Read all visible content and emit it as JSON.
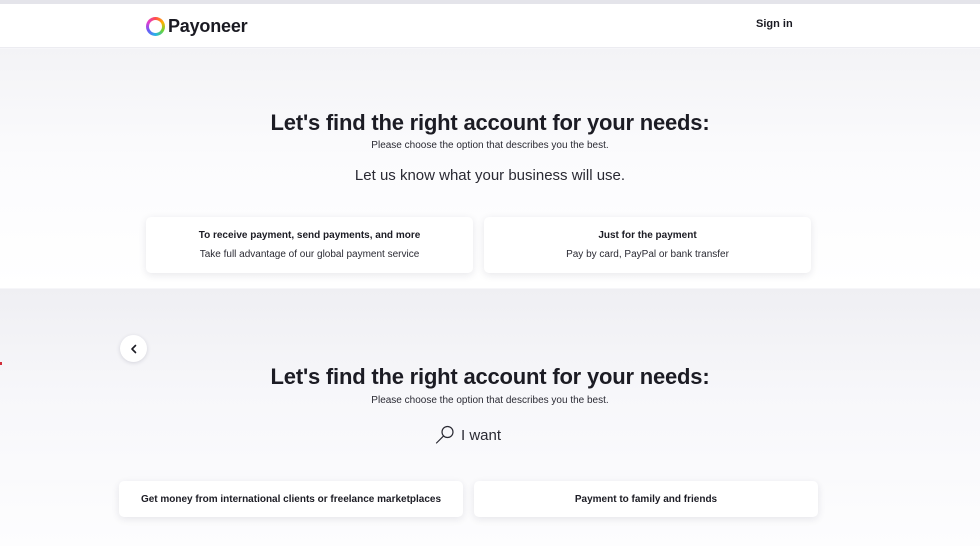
{
  "header": {
    "brand": "Payoneer",
    "signin_label": "Sign in"
  },
  "section1": {
    "title": "Let's find the right account for your needs:",
    "subtitle": "Please choose the option that describes you the best.",
    "question": "Let us know what your business will use.",
    "options": [
      {
        "title": "To receive payment, send payments, and more",
        "description": "Take full advantage of our global payment service"
      },
      {
        "title": "Just for the payment",
        "description": "Pay by card, PayPal or bank transfer"
      }
    ]
  },
  "section2": {
    "title": "Let's find the right account for your needs:",
    "subtitle": "Please choose the option that describes you the best.",
    "prompt": "I want",
    "options": [
      {
        "title": "Get money from international clients or freelance marketplaces"
      },
      {
        "title": "Payment to family and friends"
      }
    ]
  },
  "icons": {
    "logo": "payoneer-ring-logo",
    "back": "chevron-left-icon",
    "search": "magnifier-icon"
  },
  "colors": {
    "text": "#1c1c24",
    "card_bg": "#ffffff",
    "page_bg": "#f6f6f9"
  }
}
